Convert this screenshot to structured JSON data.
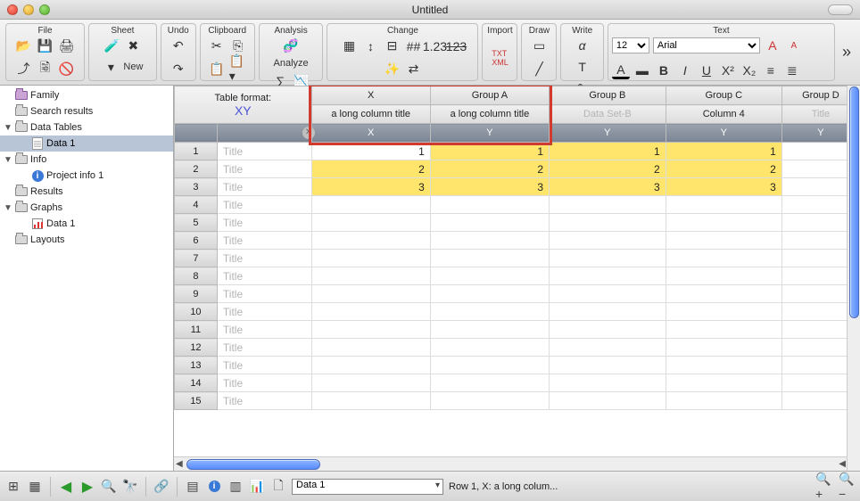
{
  "window": {
    "title": "Untitled"
  },
  "ribbon": {
    "groups": {
      "file": "File",
      "sheet": "Sheet",
      "undo": "Undo",
      "clipboard": "Clipboard",
      "analysis": "Analysis",
      "change": "Change",
      "import": "Import",
      "draw": "Draw",
      "write": "Write",
      "text": "Text"
    },
    "new_label": "New",
    "analyze_label": "Analyze",
    "font_size": "12",
    "font_name": "Arial"
  },
  "sidebar": {
    "items": [
      {
        "label": "Family",
        "kind": "folder",
        "indent": 0,
        "sel": false
      },
      {
        "label": "Search results",
        "kind": "folder-grey",
        "indent": 0,
        "sel": false
      },
      {
        "label": "Data Tables",
        "kind": "folder-grey",
        "indent": 0,
        "sel": false,
        "arrow": "▼"
      },
      {
        "label": "Data 1",
        "kind": "sheet",
        "indent": 1,
        "sel": true
      },
      {
        "label": "Info",
        "kind": "folder-grey",
        "indent": 0,
        "sel": false,
        "arrow": "▼"
      },
      {
        "label": "Project info 1",
        "kind": "info",
        "indent": 1,
        "sel": false
      },
      {
        "label": "Results",
        "kind": "folder-grey",
        "indent": 0,
        "sel": false
      },
      {
        "label": "Graphs",
        "kind": "folder-grey",
        "indent": 0,
        "sel": false,
        "arrow": "▼"
      },
      {
        "label": "Data 1",
        "kind": "graph",
        "indent": 1,
        "sel": false
      },
      {
        "label": "Layouts",
        "kind": "folder-grey",
        "indent": 0,
        "sel": false
      }
    ]
  },
  "table": {
    "format_label": "Table format:",
    "format_type": "XY",
    "groups": [
      "X",
      "Group A",
      "Group B",
      "Group C",
      "Group D"
    ],
    "column_titles": [
      "a long column title",
      "a long column title",
      "Data Set-B",
      "Column 4",
      "Title"
    ],
    "column_title_placeholder_idx": [
      2,
      4
    ],
    "subheads": [
      "X",
      "Y",
      "Y",
      "Y",
      "Y"
    ],
    "row_title_placeholder": "Title",
    "rows": [
      {
        "n": 1,
        "values": [
          "1",
          "1",
          "1",
          "1",
          ""
        ],
        "yellow": [
          false,
          true,
          true,
          true,
          false
        ]
      },
      {
        "n": 2,
        "values": [
          "2",
          "2",
          "2",
          "2",
          ""
        ],
        "yellow": [
          true,
          true,
          true,
          true,
          false
        ]
      },
      {
        "n": 3,
        "values": [
          "3",
          "3",
          "3",
          "3",
          ""
        ],
        "yellow": [
          true,
          true,
          true,
          true,
          false
        ]
      },
      {
        "n": 4,
        "values": [
          "",
          "",
          "",
          "",
          ""
        ],
        "yellow": [
          false,
          false,
          false,
          false,
          false
        ]
      },
      {
        "n": 5,
        "values": [
          "",
          "",
          "",
          "",
          ""
        ],
        "yellow": [
          false,
          false,
          false,
          false,
          false
        ]
      },
      {
        "n": 6,
        "values": [
          "",
          "",
          "",
          "",
          ""
        ],
        "yellow": [
          false,
          false,
          false,
          false,
          false
        ]
      },
      {
        "n": 7,
        "values": [
          "",
          "",
          "",
          "",
          ""
        ],
        "yellow": [
          false,
          false,
          false,
          false,
          false
        ]
      },
      {
        "n": 8,
        "values": [
          "",
          "",
          "",
          "",
          ""
        ],
        "yellow": [
          false,
          false,
          false,
          false,
          false
        ]
      },
      {
        "n": 9,
        "values": [
          "",
          "",
          "",
          "",
          ""
        ],
        "yellow": [
          false,
          false,
          false,
          false,
          false
        ]
      },
      {
        "n": 10,
        "values": [
          "",
          "",
          "",
          "",
          ""
        ],
        "yellow": [
          false,
          false,
          false,
          false,
          false
        ]
      },
      {
        "n": 11,
        "values": [
          "",
          "",
          "",
          "",
          ""
        ],
        "yellow": [
          false,
          false,
          false,
          false,
          false
        ]
      },
      {
        "n": 12,
        "values": [
          "",
          "",
          "",
          "",
          ""
        ],
        "yellow": [
          false,
          false,
          false,
          false,
          false
        ]
      },
      {
        "n": 13,
        "values": [
          "",
          "",
          "",
          "",
          ""
        ],
        "yellow": [
          false,
          false,
          false,
          false,
          false
        ]
      },
      {
        "n": 14,
        "values": [
          "",
          "",
          "",
          "",
          ""
        ],
        "yellow": [
          false,
          false,
          false,
          false,
          false
        ]
      },
      {
        "n": 15,
        "values": [
          "",
          "",
          "",
          "",
          ""
        ],
        "yellow": [
          false,
          false,
          false,
          false,
          false
        ]
      }
    ]
  },
  "status": {
    "sheet_selector": "Data 1",
    "info": "Row 1, X: a long colum..."
  }
}
